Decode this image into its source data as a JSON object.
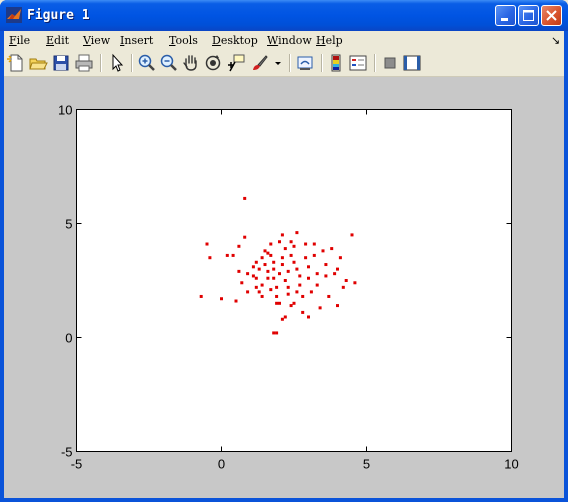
{
  "window": {
    "title": "Figure 1",
    "controls": [
      "minimize",
      "maximize",
      "close"
    ]
  },
  "menu": [
    {
      "mnemonic": "F",
      "rest": "ile"
    },
    {
      "mnemonic": "E",
      "rest": "dit"
    },
    {
      "mnemonic": "V",
      "rest": "iew"
    },
    {
      "mnemonic": "I",
      "rest": "nsert"
    },
    {
      "mnemonic": "T",
      "rest": "ools"
    },
    {
      "mnemonic": "D",
      "rest": "esktop"
    },
    {
      "mnemonic": "W",
      "rest": "indow"
    },
    {
      "mnemonic": "H",
      "rest": "elp"
    }
  ],
  "menu_overflow": "↘",
  "toolbar": {
    "icons": [
      "new-file-icon",
      "open-folder-icon",
      "save-icon",
      "print-icon",
      "pointer-icon",
      "zoom-in-icon",
      "zoom-out-icon",
      "pan-hand-icon",
      "rotate-3d-icon",
      "data-cursor-icon",
      "brush-icon",
      "link-plot-icon",
      "colorbar-icon",
      "legend-icon",
      "hide-tools-icon",
      "show-tools-icon"
    ]
  },
  "colors": {
    "marker": "#e00000",
    "axes_background": "#ffffff",
    "figure_background": "#c8c8c8"
  },
  "chart_data": {
    "type": "scatter",
    "title": "",
    "xlabel": "",
    "ylabel": "",
    "xlim": [
      -5,
      10
    ],
    "ylim": [
      -5,
      10
    ],
    "xticks": [
      "-5",
      "0",
      "5",
      "10"
    ],
    "yticks": [
      "-5",
      "0",
      "5",
      "10"
    ],
    "marker": "dot",
    "grid": false,
    "series": [
      {
        "points": [
          [
            0.8,
            6.1
          ],
          [
            -0.5,
            4.1
          ],
          [
            -0.4,
            3.5
          ],
          [
            -0.7,
            1.8
          ],
          [
            0.0,
            1.7
          ],
          [
            0.5,
            1.6
          ],
          [
            0.4,
            3.6
          ],
          [
            0.6,
            4.0
          ],
          [
            0.8,
            4.4
          ],
          [
            0.6,
            2.9
          ],
          [
            0.9,
            2.8
          ],
          [
            0.7,
            2.4
          ],
          [
            0.9,
            2.0
          ],
          [
            1.1,
            3.1
          ],
          [
            1.2,
            3.3
          ],
          [
            1.3,
            3.0
          ],
          [
            1.2,
            2.6
          ],
          [
            1.2,
            2.2
          ],
          [
            1.3,
            2.0
          ],
          [
            1.4,
            1.8
          ],
          [
            1.4,
            2.3
          ],
          [
            1.1,
            2.7
          ],
          [
            1.4,
            3.5
          ],
          [
            1.5,
            3.8
          ],
          [
            1.5,
            3.2
          ],
          [
            1.6,
            2.9
          ],
          [
            1.6,
            2.6
          ],
          [
            1.7,
            2.1
          ],
          [
            1.7,
            3.6
          ],
          [
            1.8,
            3.3
          ],
          [
            1.8,
            3.0
          ],
          [
            1.8,
            2.6
          ],
          [
            1.9,
            2.2
          ],
          [
            1.9,
            1.8
          ],
          [
            1.9,
            1.5
          ],
          [
            2.0,
            1.5
          ],
          [
            2.0,
            2.8
          ],
          [
            2.1,
            3.2
          ],
          [
            2.1,
            3.5
          ],
          [
            2.0,
            4.2
          ],
          [
            2.1,
            4.5
          ],
          [
            2.2,
            3.9
          ],
          [
            2.2,
            2.5
          ],
          [
            2.3,
            2.9
          ],
          [
            2.3,
            2.2
          ],
          [
            2.3,
            1.9
          ],
          [
            2.4,
            1.4
          ],
          [
            2.5,
            1.5
          ],
          [
            2.4,
            3.6
          ],
          [
            2.5,
            3.3
          ],
          [
            2.5,
            4.0
          ],
          [
            2.6,
            4.6
          ],
          [
            2.6,
            3.0
          ],
          [
            2.7,
            2.7
          ],
          [
            2.7,
            2.3
          ],
          [
            2.8,
            1.8
          ],
          [
            2.8,
            1.1
          ],
          [
            2.9,
            3.5
          ],
          [
            2.9,
            4.1
          ],
          [
            3.0,
            3.1
          ],
          [
            3.0,
            2.6
          ],
          [
            3.1,
            2.0
          ],
          [
            3.2,
            4.1
          ],
          [
            3.2,
            3.6
          ],
          [
            3.3,
            2.8
          ],
          [
            3.3,
            2.3
          ],
          [
            3.4,
            1.3
          ],
          [
            3.5,
            3.8
          ],
          [
            3.6,
            3.2
          ],
          [
            3.6,
            2.7
          ],
          [
            3.7,
            1.8
          ],
          [
            3.8,
            3.9
          ],
          [
            3.9,
            2.8
          ],
          [
            4.0,
            3.0
          ],
          [
            4.0,
            1.4
          ],
          [
            4.2,
            2.2
          ],
          [
            4.3,
            2.5
          ],
          [
            4.1,
            3.5
          ],
          [
            4.5,
            4.5
          ],
          [
            4.6,
            2.4
          ],
          [
            1.8,
            0.2
          ],
          [
            1.9,
            0.2
          ],
          [
            2.1,
            0.8
          ],
          [
            2.2,
            0.9
          ],
          [
            1.6,
            3.7
          ],
          [
            1.7,
            4.1
          ],
          [
            2.4,
            4.2
          ],
          [
            0.2,
            3.6
          ],
          [
            2.6,
            2.0
          ],
          [
            3.0,
            0.9
          ]
        ]
      }
    ]
  }
}
